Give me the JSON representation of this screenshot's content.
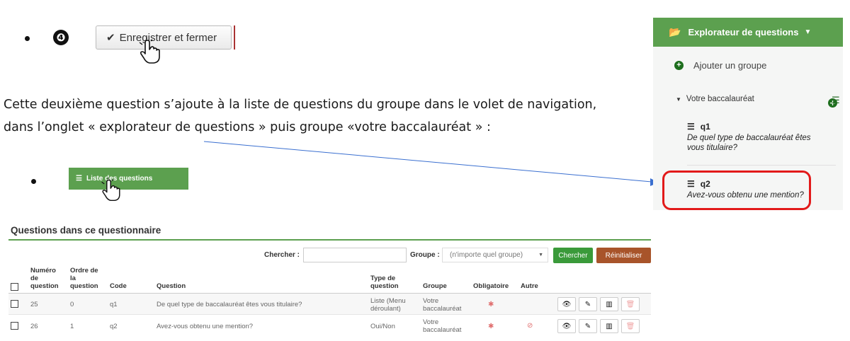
{
  "step": {
    "number": "❹",
    "save_close_label": "Enregistrer et fermer"
  },
  "paragraph": "Cette deuxième question s’ajoute à la liste de questions du groupe dans le volet de navigation, dans l’onglet « explorateur de questions » puis groupe «votre baccalauréat » :",
  "list_button_label": "Liste des questions",
  "explorer": {
    "title": "Explorateur de questions",
    "add_group": "Ajouter un groupe",
    "group_name": "Votre baccalauréat",
    "questions": [
      {
        "code": "q1",
        "text": "De quel type de baccalauréat êtes vous titulaire?"
      },
      {
        "code": "q2",
        "text": "Avez-vous obtenu une mention?"
      }
    ]
  },
  "table": {
    "title": "Questions dans ce questionnaire",
    "search_label": "Chercher :",
    "search_value": "",
    "group_label": "Groupe :",
    "group_select": "(n'importe quel groupe)",
    "search_button": "Chercher",
    "reset_button": "Réinitialiser",
    "headers": {
      "num": "Numéro de question",
      "order": "Ordre de la question",
      "code": "Code",
      "question": "Question",
      "type": "Type de question",
      "group": "Groupe",
      "mandatory": "Obligatoire",
      "other": "Autre"
    },
    "rows": [
      {
        "num": "25",
        "order": "0",
        "code": "q1",
        "question": "De quel type de baccalauréat êtes vous titulaire?",
        "type": "Liste (Menu déroulant)",
        "group": "Votre baccalauréat",
        "mandatory": "✱",
        "other": ""
      },
      {
        "num": "26",
        "order": "1",
        "code": "q2",
        "question": "Avez-vous obtenu une mention?",
        "type": "Oui/Non",
        "group": "Votre baccalauréat",
        "mandatory": "✱",
        "other": "⊘"
      }
    ]
  },
  "colors": {
    "green": "#5ca04f",
    "highlight": "#e21a1a",
    "arrow": "#3a6fd0"
  }
}
